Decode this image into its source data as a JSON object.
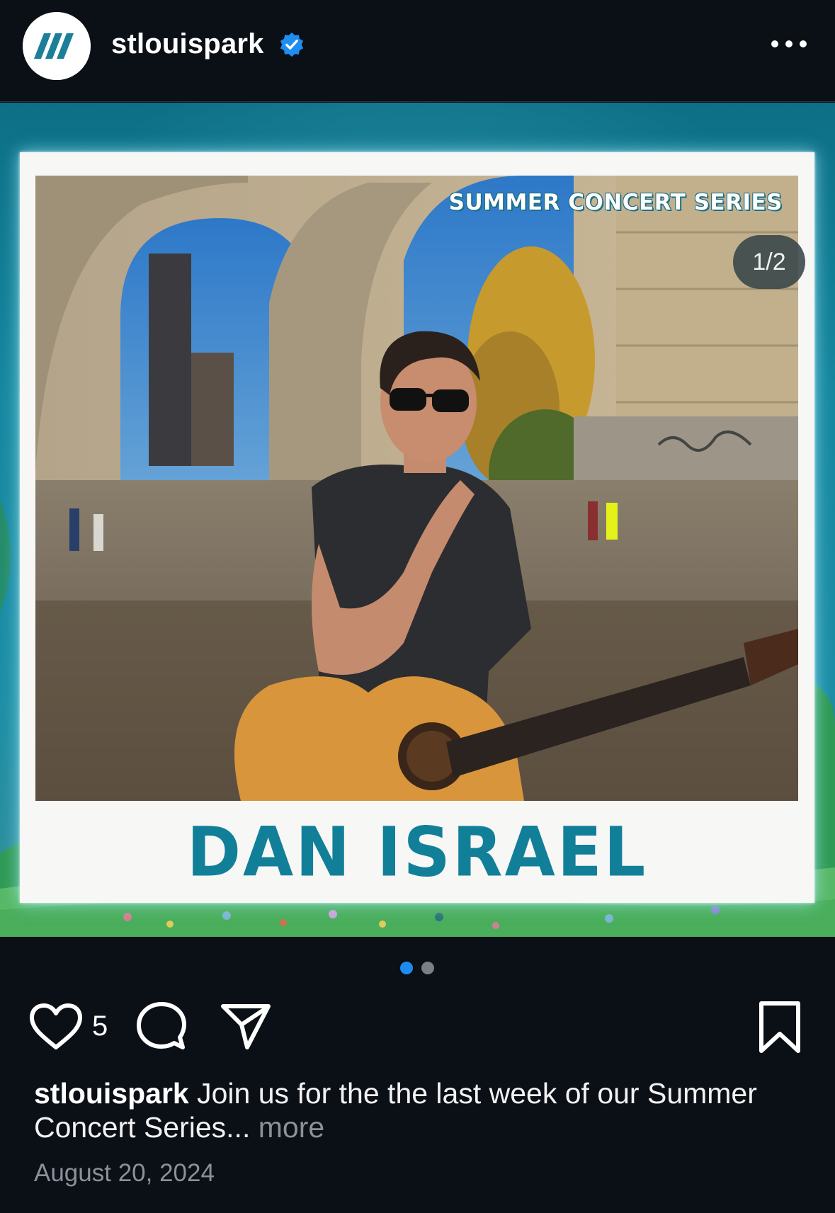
{
  "header": {
    "avatar_icon": "stlouispark-logo",
    "username": "stlouispark",
    "verified_icon": "verified-badge-icon",
    "more_icon": "more-horizontal-icon"
  },
  "post": {
    "image_counter": "1/2",
    "series_label": "SUMMER CONCERT SERIES",
    "artist_name": "DAN ISRAEL",
    "current_slide": 1,
    "total_slides": 2
  },
  "actions": {
    "like_icon": "heart-icon",
    "like_count": "5",
    "comment_icon": "comment-icon",
    "share_icon": "send-icon",
    "save_icon": "bookmark-icon"
  },
  "caption": {
    "username": "stlouispark",
    "text": " Join us for the the last week of our Summer Concert Series...",
    "more_label": " more"
  },
  "date": "August 20, 2024",
  "colors": {
    "background": "#0b0f16",
    "accent_blue": "#1d8cf0",
    "verified_blue": "#1f8ef1",
    "artist_teal": "#127f99",
    "muted_text": "#8b9099"
  }
}
